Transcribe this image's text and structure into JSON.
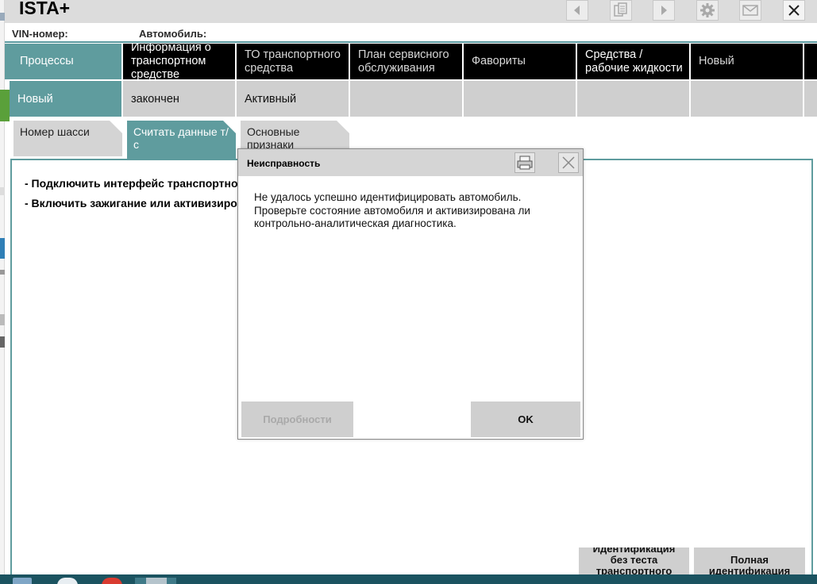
{
  "app": {
    "title": "ISTA+"
  },
  "vin_row": {
    "vin_label": "VIN-номер:",
    "vehicle_label": "Автомобиль:"
  },
  "main_tabs": [
    {
      "label": "Процессы",
      "state": "active"
    },
    {
      "label": "Информация о транспортном средстве",
      "state": "normal"
    },
    {
      "label": "ТО транспортного средства",
      "state": "dimmed"
    },
    {
      "label": "План сервисного обслуживания",
      "state": "dimmed"
    },
    {
      "label": "Фавориты",
      "state": "dimmed"
    },
    {
      "label": "Средства / рабочие жидкости",
      "state": "normal"
    },
    {
      "label": "Новый",
      "state": "dimmed"
    }
  ],
  "sub_tabs": [
    {
      "label": "Новый",
      "state": "active"
    },
    {
      "label": "закончен",
      "state": "normal"
    },
    {
      "label": "Активный",
      "state": "normal"
    },
    {
      "label": ""
    },
    {
      "label": ""
    },
    {
      "label": ""
    },
    {
      "label": ""
    }
  ],
  "folder_tabs": [
    {
      "label": "Номер шасси",
      "state": "normal"
    },
    {
      "label": "Считать данные т/с",
      "state": "active"
    },
    {
      "label": "Основные признаки",
      "state": "normal"
    }
  ],
  "instructions": [
    "- Подключить интерфейс транспортно",
    "- Включить зажигание или активизиро"
  ],
  "bottom_buttons": [
    {
      "label": "Идентификация без теста транспортного"
    },
    {
      "label": "Полная идентификация"
    }
  ],
  "dialog": {
    "title": "Неисправность",
    "message": "Не удалось успешно идентифицировать автомобиль. Проверьте состояние автомобиля и активизирована ли контрольно-аналитическая диагностика.",
    "details_label": "Подробности",
    "ok_label": "OK"
  },
  "colors": {
    "accent_teal": "#5f9c9e",
    "tab_black": "#000000",
    "button_grey": "#cfcfcf",
    "taskbar": "#1b5360"
  }
}
